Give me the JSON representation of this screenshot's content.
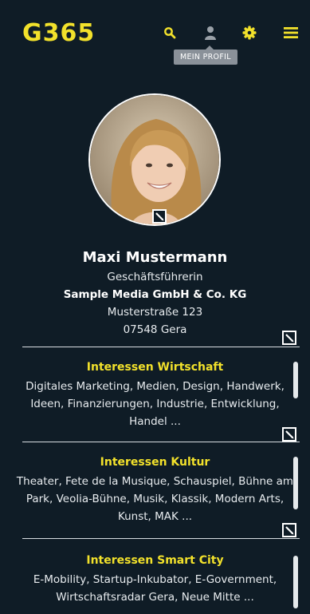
{
  "header": {
    "logo": "G365",
    "icons": [
      "search-icon",
      "user-icon",
      "gear-icon",
      "menu-icon"
    ],
    "tooltip": "MEIN PROFIL"
  },
  "colors": {
    "background": "#0f1c26",
    "accent": "#f2e12b",
    "text": "#ffffff"
  },
  "profile": {
    "name": "Maxi Mustermann",
    "position": "Geschäftsführerin",
    "company": "Sample Media GmbH & Co. KG",
    "street": "Musterstraße 123",
    "city": "07548 Gera"
  },
  "interests": [
    {
      "title": "Interessen Wirtschaft",
      "text": "Digitales Marketing, Medien, Design, Handwerk, Ideen, Finanzierungen, Industrie, Entwicklung, Handel ..."
    },
    {
      "title": "Interessen Kultur",
      "text": "Theater, Fete de la Musique, Schauspiel, Bühne am Park, Veolia-Bühne, Musik, Klassik, Modern Arts, Kunst, MAK ..."
    },
    {
      "title": "Interessen Smart City",
      "text": "E-Mobility, Startup-Inkubator, E-Government, Wirtschaftsradar Gera, Neue Mitte ..."
    }
  ]
}
